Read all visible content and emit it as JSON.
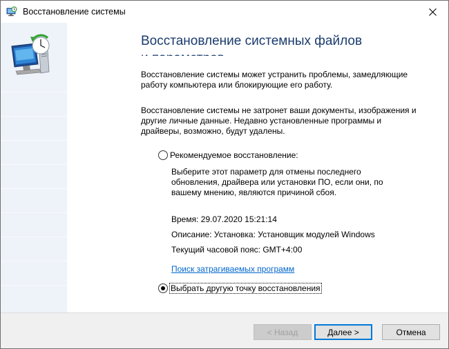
{
  "window": {
    "title": "Восстановление системы"
  },
  "content": {
    "heading": "Восстановление системных файлов и параметров",
    "paragraph1": "Восстановление системы может устранить проблемы, замедляющие работу компьютера или блокирующие его работу.",
    "paragraph2": "Восстановление системы не затронет ваши документы, изображения и другие личные данные. Недавно установленные программы и драйверы, возможно, будут удалены.",
    "recommended": {
      "label": "Рекомендуемое восстановление:",
      "checked": false,
      "description": "Выберите этот параметр для отмены последнего обновления, драйвера или установки ПО, если они, по вашему мнению, являются причиной сбоя.",
      "time": "Время: 29.07.2020 15:21:14",
      "description_line": "Описание: Установка: Установщик модулей Windows",
      "timezone": "Текущий часовой пояс: GMT+4:00",
      "scan_link": "Поиск затрагиваемых программ"
    },
    "other_point": {
      "label": "Выбрать другую точку восстановления",
      "checked": true
    }
  },
  "footer": {
    "back_label": "< Назад",
    "next_label": "Далее >",
    "cancel_label": "Отмена"
  },
  "icons": {
    "title": "system-restore-icon",
    "banner": "system-restore-large-icon",
    "close": "close-icon"
  },
  "colors": {
    "heading": "#1a3b6d",
    "link": "#0066cc",
    "banner_bg": "#eef3f9",
    "accent": "#0078d7"
  }
}
